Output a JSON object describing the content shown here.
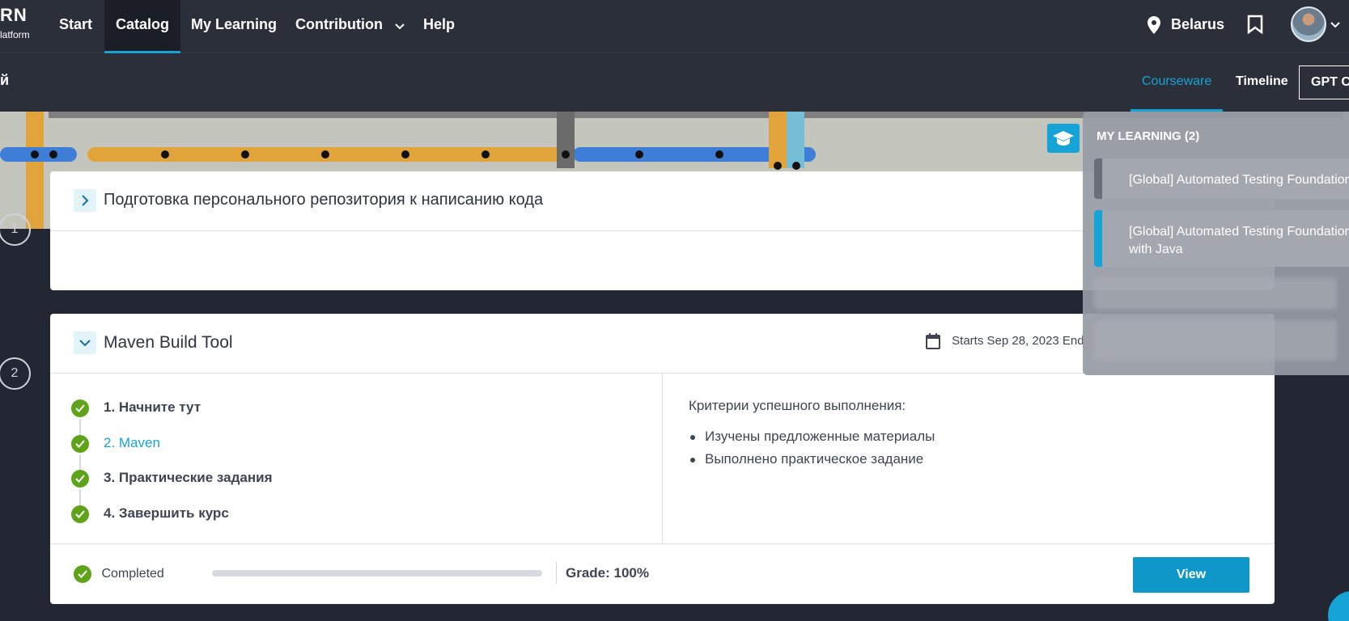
{
  "app": {
    "logo_main": "RN",
    "logo_sub": "latform"
  },
  "topnav": {
    "items": [
      {
        "label": "Start"
      },
      {
        "label": "Catalog",
        "active": true
      },
      {
        "label": "My Learning"
      },
      {
        "label": "Contribution"
      },
      {
        "label": "Help"
      }
    ],
    "location": "Belarus",
    "icons": {
      "location": "map-pin-icon",
      "bookmark": "bookmark-icon",
      "avatar": "user-avatar",
      "chevron": "chevron-down-icon"
    }
  },
  "subnav": {
    "left_fragment": "й",
    "tabs": [
      {
        "label": "Courseware",
        "active": true
      },
      {
        "label": "Timeline"
      }
    ],
    "gpt_button": "GPT Co"
  },
  "sections": [
    {
      "number": "1",
      "title": "Подготовка персонального репозитория к написанию кода",
      "expanded": false
    },
    {
      "number": "2",
      "title": "Maven Build Tool",
      "expanded": true,
      "dates": "Starts Sep 28, 2023 End",
      "lessons": [
        {
          "label": "1. Начните тут",
          "done": true,
          "current": false
        },
        {
          "label": "2. Maven",
          "done": true,
          "current": true
        },
        {
          "label": "3. Практические задания",
          "done": true,
          "current": false
        },
        {
          "label": "4. Завершить курс",
          "done": true,
          "current": false
        }
      ],
      "criteria_title": "Критерии успешного выполнения:",
      "criteria": [
        "Изучены предложенные материалы",
        "Выполнено практическое задание"
      ],
      "status": "Completed",
      "progress": 1.0,
      "grade": "Grade: 100%",
      "view_button": "View"
    }
  ],
  "dropdown": {
    "title": "MY LEARNING (2)",
    "items": [
      {
        "label": "[Global] Automated Testing Foundation",
        "active": false
      },
      {
        "label": "[Global] Automated Testing Foundation",
        "label2": "with Java",
        "active": true
      }
    ]
  },
  "colors": {
    "accent": "#16a4d6",
    "success": "#5fa31b",
    "nav_bg": "#2b2f3a",
    "page_bg": "#232733"
  }
}
